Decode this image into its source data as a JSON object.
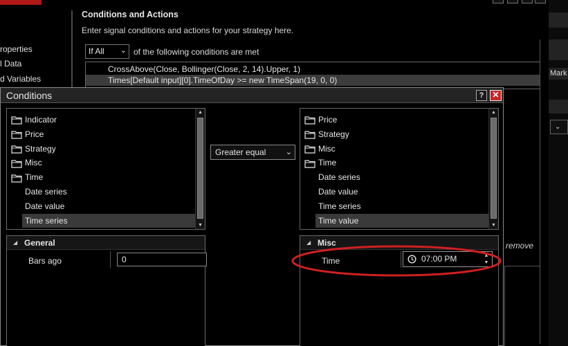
{
  "background": {
    "nav_items": [
      "roperties",
      "l Data",
      "d Variables"
    ],
    "section_title": "Conditions and Actions",
    "section_description": "Enter signal conditions and actions for your strategy here.",
    "match_select": "If All",
    "match_suffix": "of the following conditions are met",
    "conditions": [
      "CrossAbove(Close, Bollinger(Close, 2, 14).Upper, 1)",
      "Times[Default input][0].TimeOfDay >= new TimeSpan(19, 0, 0)"
    ],
    "remove_label": "remove",
    "far_right_label": "Mark"
  },
  "dialog": {
    "title": "Conditions",
    "help_label": "?",
    "close_label": "✕",
    "left_tree": [
      {
        "label": "Indicator",
        "folder": true,
        "selected": false
      },
      {
        "label": "Price",
        "folder": true,
        "selected": false
      },
      {
        "label": "Strategy",
        "folder": true,
        "selected": false
      },
      {
        "label": "Misc",
        "folder": true,
        "selected": false
      },
      {
        "label": "Time",
        "folder": true,
        "selected": false
      },
      {
        "label": "Date series",
        "folder": false,
        "selected": false
      },
      {
        "label": "Date value",
        "folder": false,
        "selected": false
      },
      {
        "label": "Time series",
        "folder": false,
        "selected": true
      }
    ],
    "operator": "Greater equal",
    "right_tree": [
      {
        "label": "Price",
        "folder": true,
        "selected": false
      },
      {
        "label": "Strategy",
        "folder": true,
        "selected": false
      },
      {
        "label": "Misc",
        "folder": true,
        "selected": false
      },
      {
        "label": "Time",
        "folder": true,
        "selected": false
      },
      {
        "label": "Date series",
        "folder": false,
        "selected": false
      },
      {
        "label": "Date value",
        "folder": false,
        "selected": false
      },
      {
        "label": "Time series",
        "folder": false,
        "selected": false
      },
      {
        "label": "Time value",
        "folder": false,
        "selected": true
      }
    ],
    "left_props": {
      "section": "General",
      "field_label": "Bars ago",
      "field_value": "0"
    },
    "right_props": {
      "section": "Misc",
      "field_label": "Time",
      "field_value": "07:00 PM"
    }
  },
  "colors": {
    "close_button": "#c82626",
    "highlight_ellipse": "#d02020",
    "selection": "#3a3a3a"
  }
}
